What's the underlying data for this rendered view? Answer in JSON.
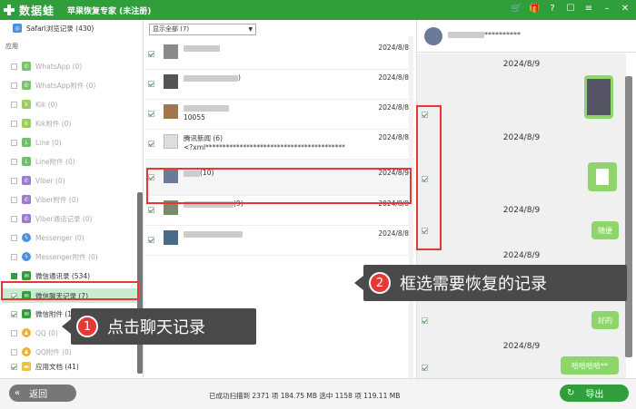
{
  "titlebar": {
    "brand": "数据蛙",
    "title": "苹果恢复专家 (未注册)",
    "icons": [
      "cart-icon",
      "gift-icon",
      "help-icon",
      "chat-icon",
      "menu-icon",
      "minimize-icon",
      "close-icon"
    ]
  },
  "sidebar": {
    "top_item": "Safari浏览记录 (430)",
    "section": "应用",
    "items": [
      {
        "label": "WhatsApp (0)",
        "color": "#7ac36a"
      },
      {
        "label": "WhatsApp附件 (0)",
        "color": "#7ac36a"
      },
      {
        "label": "Kik (0)",
        "color": "#9ccc5a"
      },
      {
        "label": "Kik附件 (0)",
        "color": "#9ccc5a"
      },
      {
        "label": "Line (0)",
        "color": "#6ac16a"
      },
      {
        "label": "Line附件 (0)",
        "color": "#6ac16a"
      },
      {
        "label": "Viber (0)",
        "color": "#9b7ad0"
      },
      {
        "label": "Viber附件 (0)",
        "color": "#9b7ad0"
      },
      {
        "label": "Viber通话记录 (0)",
        "color": "#9b7ad0"
      },
      {
        "label": "Messenger (0)",
        "color": "#4a90e2"
      },
      {
        "label": "Messenger附件 (0)",
        "color": "#4a90e2"
      },
      {
        "label": "微信通讯录 (534)",
        "color": "#2f9e3b"
      },
      {
        "label": "微信聊天记录 (7)",
        "color": "#2f9e3b"
      },
      {
        "label": "微信附件 (10)",
        "color": "#2f9e3b"
      },
      {
        "label": "QQ (0)",
        "color": "#f0b030"
      },
      {
        "label": "QQ附件 (0)",
        "color": "#f0b030"
      },
      {
        "label": "应用文档 (41)",
        "color": "#f0c040"
      }
    ]
  },
  "middle": {
    "filter": "显示全部 (7)",
    "rows": [
      {
        "name": "",
        "preview": "",
        "date": "2024/8/8"
      },
      {
        "name": ")",
        "preview": "",
        "date": "2024/8/8"
      },
      {
        "name": "",
        "preview": "10055",
        "date": "2024/8/8"
      },
      {
        "name": "腾讯新闻 (6)",
        "preview": "<?xml*****************************************",
        "date": "2024/8/8"
      },
      {
        "name": "(10)",
        "preview": "",
        "date": "2024/8/9"
      },
      {
        "name": "(9)",
        "preview": "",
        "date": "2024/8/8"
      },
      {
        "name": "",
        "preview": "",
        "date": "2024/8/8"
      }
    ]
  },
  "chat": {
    "contact": "**********",
    "dates": [
      "2024/8/9",
      "2024/8/9",
      "2024/8/9",
      "2024/8/9",
      "2024/8/9"
    ],
    "bubbles": {
      "b3": "随便",
      "b5": "好的",
      "b6": "哈哈哈哈**"
    }
  },
  "callouts": {
    "c1_num": "1",
    "c1_text": "点击聊天记录",
    "c2_num": "2",
    "c2_text": "框选需要恢复的记录"
  },
  "bottom": {
    "back": "返回",
    "status": "已成功扫描到 2371 项 184.75 MB  选中 1158 项 119.11 MB",
    "export": "导出"
  }
}
